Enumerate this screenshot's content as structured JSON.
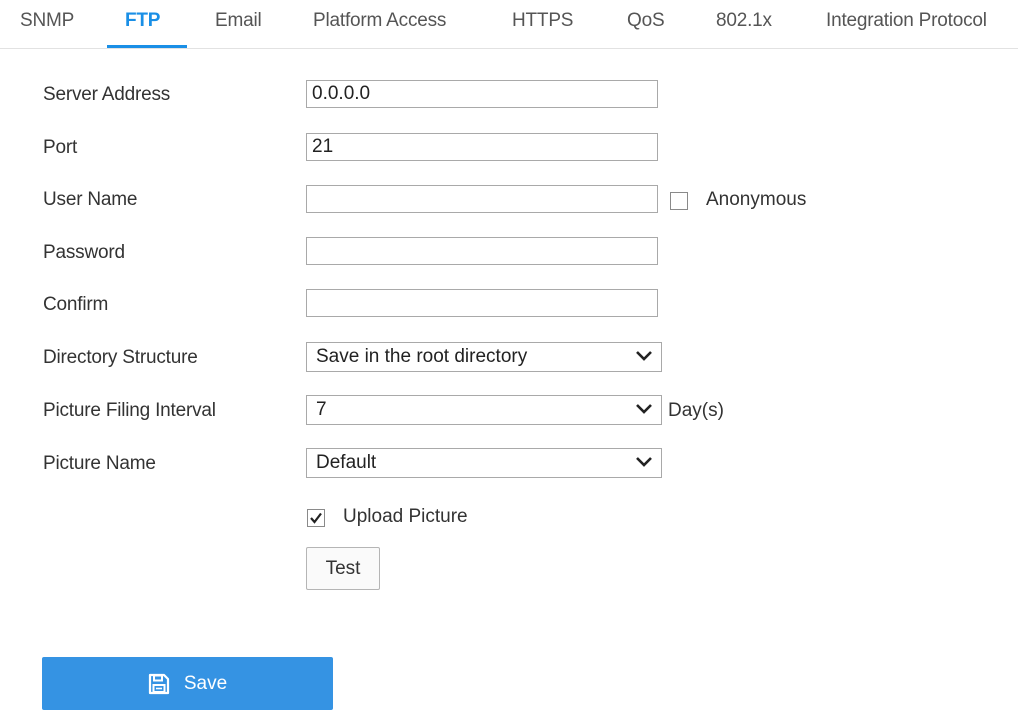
{
  "tabs": [
    {
      "label": "SNMP",
      "active": false
    },
    {
      "label": "FTP",
      "active": true
    },
    {
      "label": "Email",
      "active": false
    },
    {
      "label": "Platform Access",
      "active": false
    },
    {
      "label": "HTTPS",
      "active": false
    },
    {
      "label": "QoS",
      "active": false
    },
    {
      "label": "802.1x",
      "active": false
    },
    {
      "label": "Integration Protocol",
      "active": false
    }
  ],
  "form": {
    "server_address": {
      "label": "Server Address",
      "value": "0.0.0.0"
    },
    "port": {
      "label": "Port",
      "value": "21"
    },
    "user_name": {
      "label": "User Name",
      "value": ""
    },
    "anonymous": {
      "label": "Anonymous",
      "checked": false
    },
    "password": {
      "label": "Password",
      "value": ""
    },
    "confirm": {
      "label": "Confirm",
      "value": ""
    },
    "directory_structure": {
      "label": "Directory Structure",
      "value": "Save in the root directory"
    },
    "picture_filing_interval": {
      "label": "Picture Filing Interval",
      "value": "7",
      "unit": "Day(s)"
    },
    "picture_name": {
      "label": "Picture Name",
      "value": "Default"
    },
    "upload_picture": {
      "label": "Upload Picture",
      "checked": true
    }
  },
  "buttons": {
    "test_label": "Test",
    "save_label": "Save"
  },
  "colors": {
    "accent": "#1a8fe6",
    "save_button": "#3593e3"
  },
  "icons": {
    "save": "floppy-disk-icon",
    "dropdown": "chevron-down-icon",
    "check": "check-icon"
  }
}
